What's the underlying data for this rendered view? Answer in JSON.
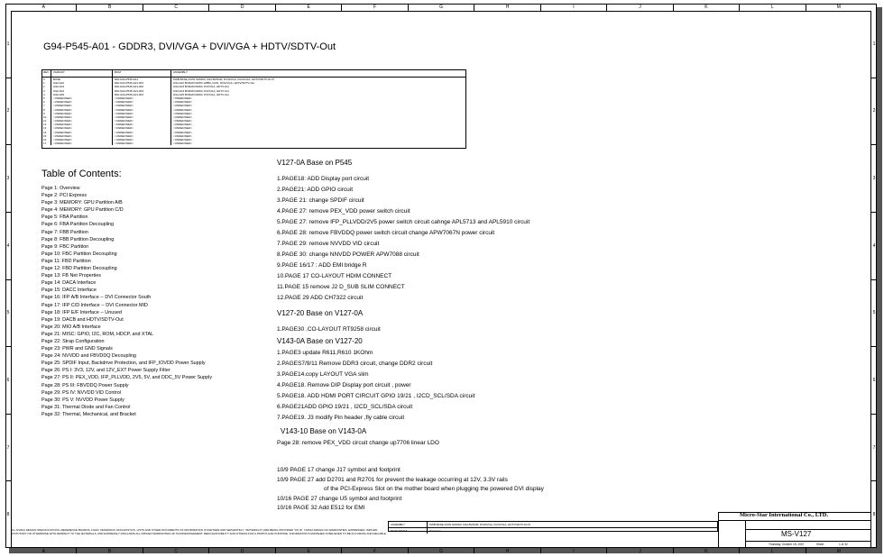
{
  "header": {
    "title": "G94-P545-A01 - GDDR3, DVI/VGA + DVI/VGA + HDTV/SDTV-Out",
    "column_markers": [
      "A",
      "B",
      "C",
      "D",
      "E",
      "F",
      "G",
      "H",
      "I",
      "J",
      "K",
      "L",
      "M"
    ],
    "row_markers": [
      "1",
      "2",
      "3",
      "4",
      "5",
      "6",
      "7",
      "8"
    ]
  },
  "revision_table": {
    "columns": [
      "REV",
      "VARIANT",
      "BOM",
      "ASSEMBLY"
    ],
    "rows": [
      [
        "0",
        "BASE",
        "600-G94-P545-A01",
        "PWB BASE (DVI0 GDDR3, G94 BVRAM, DVI0/VGA, DVI1/VGA, HDTV/SDTV-OUT)"
      ],
      [
        "1",
        "G92-A02",
        "600-G94-P545-A01-001",
        "G94-A02 BVRAM DDR3 128Bit, DVI0, DVI1/VGA, HDTV/SDTV-Out"
      ],
      [
        "2",
        "G92-A03",
        "600-G94-P545-A01-002",
        "G94-A03 BVRAM DDR3, DVI/VGA, HDTV-Out"
      ],
      [
        "3",
        "G92-A04",
        "600-G94-P545-A01-003",
        "G94-A04 BVRAM DDR3, DVI/VGA, HDTV-Out"
      ],
      [
        "4",
        "G92-A05",
        "600-G94-P545-A01-004",
        "G94-A05 BVRAM DDR3, DVI/VGA, HDTV-Out"
      ],
      [
        "5",
        "<UNDEFINED>",
        "<UNDEFINED>",
        "<UNDEFINED>"
      ],
      [
        "6",
        "<UNDEFINED>",
        "<UNDEFINED>",
        "<UNDEFINED>"
      ],
      [
        "7",
        "<UNDEFINED>",
        "<UNDEFINED>",
        "<UNDEFINED>"
      ],
      [
        "8",
        "<UNDEFINED>",
        "<UNDEFINED>",
        "<UNDEFINED>"
      ],
      [
        "9",
        "<UNDEFINED>",
        "<UNDEFINED>",
        "<UNDEFINED>"
      ],
      [
        "10",
        "<UNDEFINED>",
        "<UNDEFINED>",
        "<UNDEFINED>"
      ],
      [
        "11",
        "<UNDEFINED>",
        "<UNDEFINED>",
        "<UNDEFINED>"
      ],
      [
        "12",
        "<UNDEFINED>",
        "<UNDEFINED>",
        "<UNDEFINED>"
      ],
      [
        "13",
        "<UNDEFINED>",
        "<UNDEFINED>",
        "<UNDEFINED>"
      ],
      [
        "14",
        "<UNDEFINED>",
        "<UNDEFINED>",
        "<UNDEFINED>"
      ],
      [
        "15",
        "<UNDEFINED>",
        "<UNDEFINED>",
        "<UNDEFINED>"
      ],
      [
        "16",
        "<UNDEFINED>",
        "<UNDEFINED>",
        "<UNDEFINED>"
      ],
      [
        "17",
        "<UNDEFINED>",
        "<UNDEFINED>",
        "<UNDEFINED>"
      ]
    ]
  },
  "toc": {
    "heading": "Table of Contents:",
    "items": [
      "Page 1: Overview",
      "Page 2: PCI Express",
      "Page 3: MEMORY: GPU Partition A/B",
      "Page 4: MEMORY: GPU Partition C/D",
      "Page 5: FBA Partition",
      "Page 6: FBA Partition Decoupling",
      "Page 7: FBB Partition",
      "Page 8: FBB Partition Decoupling",
      "Page 9: FBC Partition",
      "Page 10: FBC Partition Decoupling",
      "Page 11: FBD Partition",
      "Page 12: FBD Partition Decoupling",
      "Page 13: FB Net Properties",
      "Page 14: DACA Interface",
      "Page 15: DACC Interface",
      "Page 16: IFP A/B Interface -- DVI Connector South",
      "Page 17: IFP C/D Interface -- DVI Connector MID",
      "Page 18: IFP E/F Interface -- Unused",
      "Page 19: DACB and HDTV/SDTV-Out",
      "Page 20: MIO A/B Interface",
      "Page 21: MISC: GPIO, I2C, ROM, HDCP, and XTAL",
      "Page 22: Strap Configuration",
      "Page 23: PWR and GND Signals",
      "Page 24: NVVDD and FBVDDQ Decoupling",
      "Page 25: SPDIF Input, Backdrive Protection, and IFP_IOVDD Power Supply",
      "Page 26: PS I: 3V3, 12V, and 12V_EXT Power Supply Filter",
      "Page 27: PS II: PEX_VDD, IFP_PLLVDD, 2V5, 5V, and DDC_5V Power Supply",
      "Page 28: PS III: FBVDDQ Power Supply",
      "Page 29: PS IV: NVVDD VID Control",
      "Page 30: PS V: NVVDD Power Supply",
      "Page 31: Thermal Diode and Fan Control",
      "Page 32: Thermal, Mechanical, and Bracket"
    ]
  },
  "notes": {
    "s1_title": "V127-0A Base on  P545",
    "s1_items": [
      "1.PAGE18: ADD Display port circuit",
      "2.PAGE21: ADD GPIO circuit",
      "3.PAGE 21: change  SPDIF  circuit",
      "4.PAGE 27: remove PEX_VDD power switch  circuit",
      "5.PAGE 27: remove IFP_PLLVDD/2V5 power switch  circuit  cahnge  APL5713 and  APL5910 circuit",
      "6.PAGE 28: remove FBVDDQ power switch  circuit   change APW7067N power circuit",
      "7.PAGE 29: remove NVVDD VID circuit",
      "8.PAGE 30: change NNVDD POWER APW7088 circuit",
      "9.PAGE 16/17 : ADD EMI bridge R",
      "10.PAGE 17 CO-LAYOUT HDIM CONNECT",
      "11.PAGE 15 remove J2 D_SUB SLIM CONNECT",
      "12.PAGE 29 ADD CH7322 circuit"
    ],
    "s2_title": "V127-20 Base on  V127-0A",
    "s2_items": [
      "1.PAGE30 .CO-LAYOUT RT9258  circuit"
    ],
    "s3_title": "V143-0A Base on  V127-20",
    "s3_items": [
      "1.PAGE3 update R611,R610 1KOhm",
      "2.PAGES7/9/11 Remove DDR3 circuit, change  DDR2 circuit",
      "3.PAGE14.copy LAYOUT VGA slim",
      "4.PAGE18. Remove DIP Display port  circuit , power",
      "5.PAGE18. ADD HDMI PORT CIRCUIT GPIO 19/21 , I2CD_SCL/SDA  circuit",
      "6.PAGE21ADD GPIO 19/21 , I2CD_SCL/SDA  circuit",
      "7.PAGE19. J3 modify Pin header ,fly cable circuit"
    ],
    "s4_title": "V143-10 Base on  V143-0A",
    "s4_items": [
      "Page 28: remove  PEX_VDD circuit change up7706 linear  LDO"
    ],
    "s5_items": [
      "10/9 PAGE 17  change J17 symbol and footprint",
      "10/9 PAGE 27  add D2701 and R2701 for prevent the leakage occurring at 12V, 3.3V rails",
      "of the PCI-Express Slot on the mother board when plugging the powered DVI display",
      "10/16 PAGE 27  change U5 symbol and footprint",
      "10/16 PAGE 32  Add E512 for EMI"
    ]
  },
  "footer": {
    "disclaimer": "ALL NVIDIA DESIGN SPECIFICATIONS, REFERENCE BOARDS, FILES, DRAWINGS, DIAGNOSTICS, LISTS AND OTHER DOCUMENTS OF INFORMATION (TOGETHER AND SEPARATELY, \"MATERIALS\") ARE BEING PROVIDED \"AS IS\". NVIDIA MAKES NO WARRANTIES, EXPRESSED, IMPLIED, STATUTORY OR OTHERWISE WITH RESPECT TO THE MATERIALS, AND EXPRESSLY DISCLAIMS ALL IMPLIED WARRANTIES OF NONINFRINGEMENT, MERCHANTABILITY AND FITNESS FOR A PARTICULAR PURPOSE. INFORMATION FURNISHED IS BELIEVED TO BE ACCURATE AND RELIABLE.",
    "mid_rows": [
      [
        "ASSEMBLY",
        "PWB BASE (DVI0 GDDR3, G94 BVRAM, DVI0/VGA, DVI1/VGA, HDTV/SDTV-OUT)"
      ],
      [
        "PAGE DETAIL",
        "Overview"
      ]
    ],
    "company": "Micro-Star International Co., LTD.",
    "model": "MS-V127",
    "date": "Thursday, October 18, 2007",
    "sheet_label": "Sheet",
    "sheet_value": "1 of 32"
  }
}
